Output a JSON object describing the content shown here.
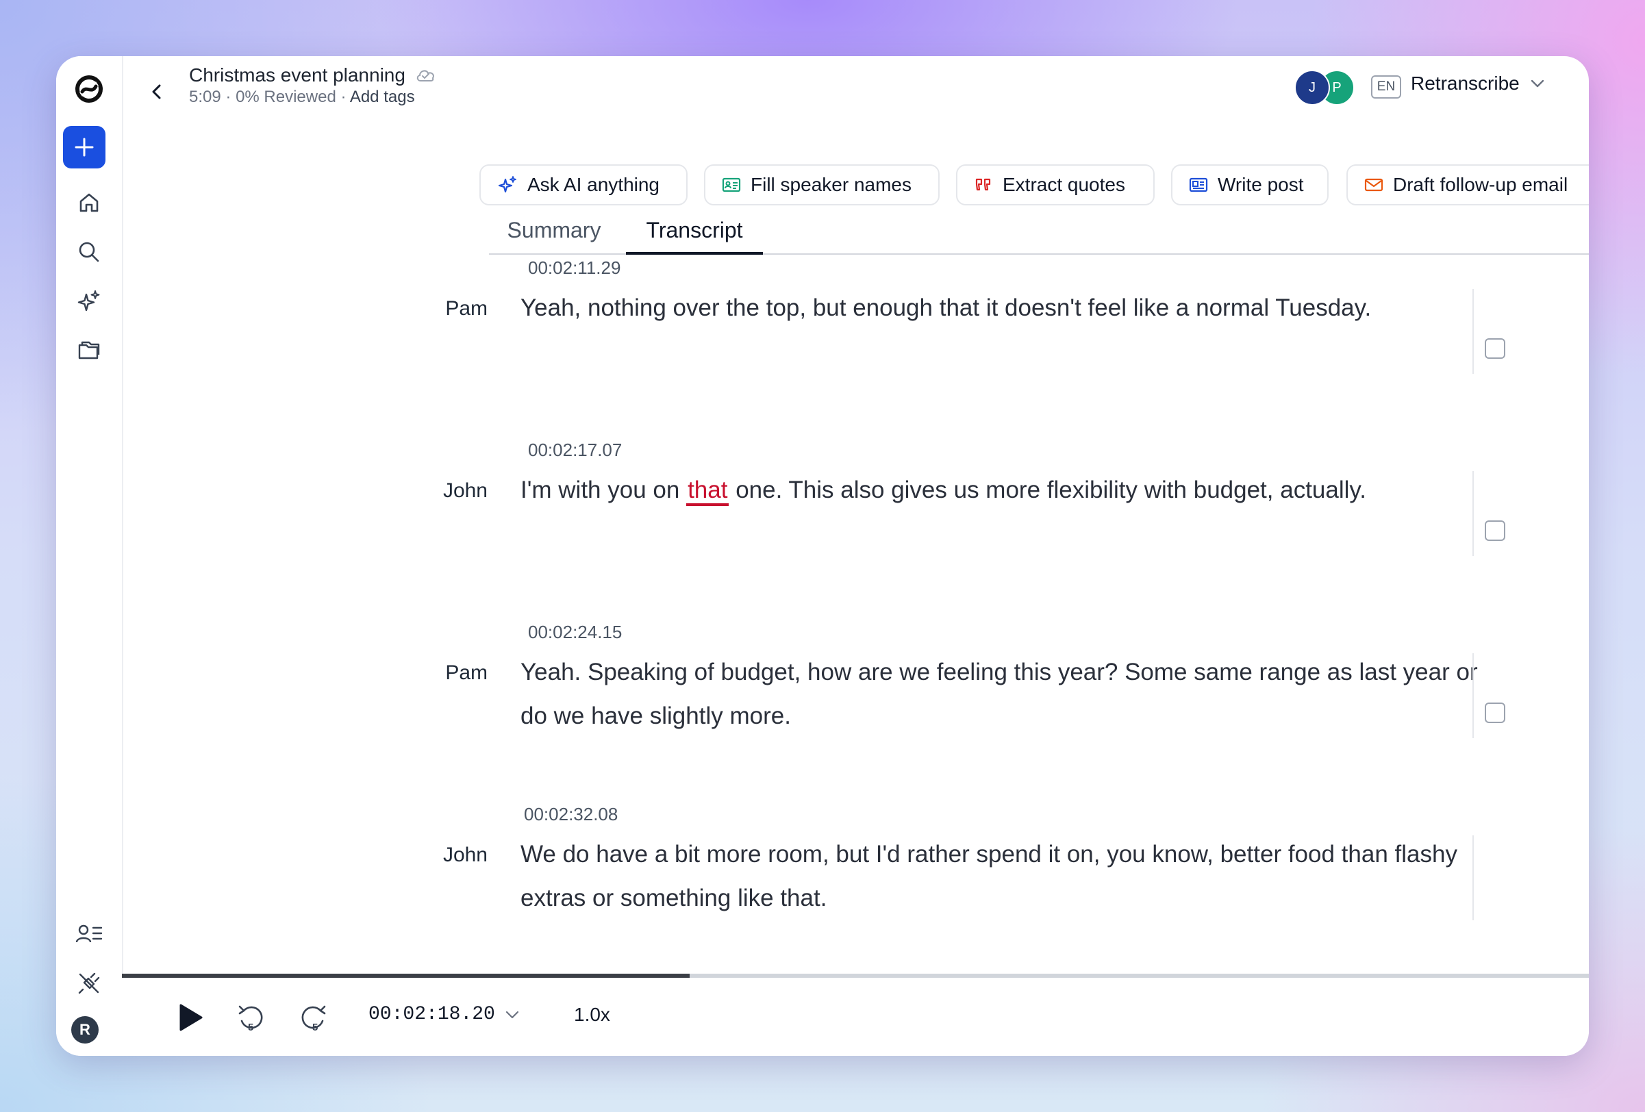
{
  "header": {
    "title": "Christmas event planning",
    "duration": "5:09",
    "reviewed": "0% Reviewed",
    "add_tags": "Add tags",
    "language": "EN",
    "retranscribe": "Retranscribe",
    "participants": [
      {
        "initial": "J",
        "color": "#1e3a8a"
      },
      {
        "initial": "P",
        "color": "#16a37a"
      }
    ]
  },
  "sidebar": {
    "avatar_initial": "R",
    "accent": "#1a4fe0"
  },
  "actions": {
    "ask_ai": "Ask AI anything",
    "fill_speakers": "Fill speaker names",
    "extract_quotes": "Extract quotes",
    "write_post": "Write post",
    "draft_email": "Draft follow-up email"
  },
  "tabs": {
    "summary": "Summary",
    "transcript": "Transcript",
    "active": "Transcript"
  },
  "transcript": [
    {
      "timestamp": "00:02:11.29",
      "speaker": "Pam",
      "text": "Yeah, nothing over the top, but enough that it doesn't feel like a normal Tuesday."
    },
    {
      "timestamp": "00:02:17.07",
      "speaker": "John",
      "text_before": "I'm with you on",
      "highlight": "that",
      "text_after": "one. This also gives us more flexibility with budget, actually."
    },
    {
      "timestamp": "00:02:24.15",
      "speaker": "Pam",
      "text": "Yeah. Speaking of budget, how are we feeling this year? Some same range as last year or do we have slightly more."
    },
    {
      "timestamp": "00:02:32.08",
      "speaker": "John",
      "text": "We do have a bit more room, but I'd rather spend it on, you know, better food than flashy extras or something like that."
    }
  ],
  "player": {
    "current_time": "00:02:18.20",
    "speed": "1.0x",
    "skip_back_seconds": "5",
    "skip_forward_seconds": "5",
    "progress_fraction": 0.387
  }
}
